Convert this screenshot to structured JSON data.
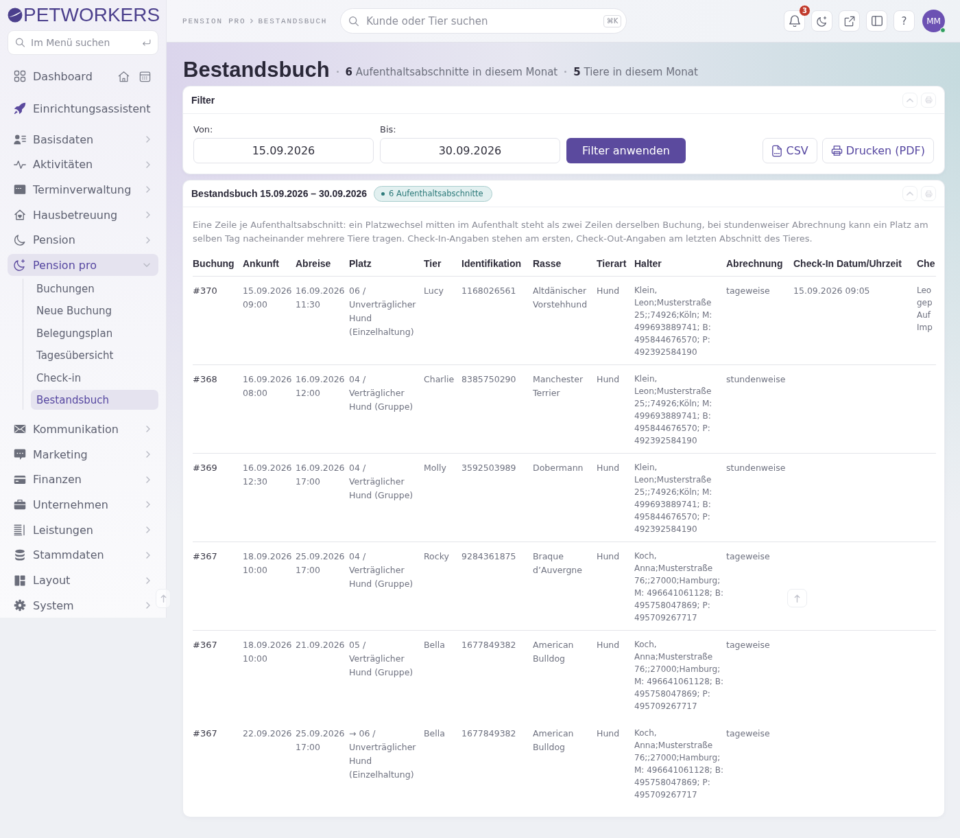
{
  "sidebar": {
    "logo": "PETWORKERS",
    "search": {
      "placeholder": "Im Menü suchen"
    },
    "items": [
      {
        "label": "Dashboard",
        "kind": "shortcuts",
        "selected": false
      },
      {
        "label": "Einrichtungsassistent",
        "kind": "link",
        "selected": false
      },
      {
        "label": "Basisdaten",
        "kind": "group",
        "selected": false,
        "expanded": false
      },
      {
        "label": "Aktivitäten",
        "kind": "group",
        "selected": false,
        "expanded": false
      },
      {
        "label": "Terminverwaltung",
        "kind": "group",
        "selected": false,
        "expanded": false
      },
      {
        "label": "Hausbetreuung",
        "kind": "group",
        "selected": false,
        "expanded": false
      },
      {
        "label": "Pension",
        "kind": "group",
        "selected": false,
        "expanded": false
      },
      {
        "label": "Pension pro",
        "kind": "group",
        "selected": true,
        "expanded": true,
        "children": [
          {
            "label": "Buchungen",
            "selected": false
          },
          {
            "label": "Neue Buchung",
            "selected": false
          },
          {
            "label": "Belegungsplan",
            "selected": false
          },
          {
            "label": "Tagesübersicht",
            "selected": false
          },
          {
            "label": "Check-in",
            "selected": false
          },
          {
            "label": "Bestandsbuch",
            "selected": true
          }
        ]
      },
      {
        "label": "Kommunikation",
        "kind": "group",
        "selected": false,
        "expanded": false
      },
      {
        "label": "Marketing",
        "kind": "group",
        "selected": false,
        "expanded": false
      },
      {
        "label": "Finanzen",
        "kind": "group",
        "selected": false,
        "expanded": false
      },
      {
        "label": "Unternehmen",
        "kind": "group",
        "selected": false,
        "expanded": false
      },
      {
        "label": "Leistungen",
        "kind": "group",
        "selected": false,
        "expanded": false
      },
      {
        "label": "Stammdaten",
        "kind": "group",
        "selected": false,
        "expanded": false
      },
      {
        "label": "Layout",
        "kind": "group",
        "selected": false,
        "expanded": false
      },
      {
        "label": "System",
        "kind": "group",
        "selected": false,
        "expanded": false
      }
    ]
  },
  "header": {
    "breadcrumb": [
      "PENSION PRO",
      "BESTANDSBUCH"
    ],
    "search": {
      "placeholder": "Kunde oder Tier suchen",
      "shortcut": "⌘K"
    },
    "notifications": {
      "count": "3"
    },
    "help": "?",
    "avatar": {
      "initials": "MM",
      "online": true
    }
  },
  "page": {
    "title": "Bestandsbuch",
    "stats": [
      "**6** Aufenthaltsabschnitte in diesem Monat",
      "**5** Tiere in diesem Monat"
    ]
  },
  "filter": {
    "title": "Filter",
    "fields": [
      {
        "label": "Von:",
        "value": "15.09.2026"
      },
      {
        "label": "Bis:",
        "value": "30.09.2026"
      }
    ],
    "apply_button": "Filter anwenden",
    "export_buttons": [
      {
        "kind": "csv",
        "label": "CSV"
      },
      {
        "kind": "print",
        "label": "Drucken (PDF)"
      }
    ]
  },
  "register": {
    "title": "Bestandsbuch 15.09.2026 – 30.09.2026",
    "badge": "6 Aufenthaltsabschnitte",
    "description": "Eine Zeile je Aufenthaltsabschnitt: ein Platzwechsel mitten im Aufenthalt steht als zwei Zeilen derselben Buchung, bei stundenweiser Abrechnung kann ein Platz am selben Tag nacheinander mehrere Tiere tragen. Check-In-Angaben stehen am ersten, Check-Out-Angaben am letzten Abschnitt des Tieres.",
    "table": {
      "columns": [
        "Buchung",
        "Ankunft",
        "Abreise",
        "Platz",
        "Tier",
        "Identifikation",
        "Rasse",
        "Tierart",
        "Halter",
        "Abrechnung",
        "Check-In Datum/Uhrzeit",
        "Che"
      ],
      "rows": [
        {
          "continued": false,
          "booking": "#370",
          "arrival": "15.09.2026 09:00",
          "departure": "16.09.2026 11:30",
          "place": "06 / Unverträglicher Hund (Einzelhaltung)",
          "animal": "Lucy",
          "id_number": "1168026561",
          "breed": "Altdänischer Vorstehhund",
          "species": "Hund",
          "owner": "Klein, Leon;Musterstraße 25;;74926;Köln; M: 499693889741; B: 495844676570; P: 492392584190",
          "billing": "tageweise",
          "check_in": "15.09.2026 09:05",
          "column_12": "Leo gep Auf Imp"
        },
        {
          "continued": false,
          "booking": "#368",
          "arrival": "16.09.2026 08:00",
          "departure": "16.09.2026 12:00",
          "place": "04 / Verträglicher Hund (Gruppe)",
          "animal": "Charlie",
          "id_number": "8385750290",
          "breed": "Manchester Terrier",
          "species": "Hund",
          "owner": "Klein, Leon;Musterstraße 25;;74926;Köln; M: 499693889741; B: 495844676570; P: 492392584190",
          "billing": "stundenweise"
        },
        {
          "continued": false,
          "booking": "#369",
          "arrival": "16.09.2026 12:30",
          "departure": "16.09.2026 17:00",
          "place": "04 / Verträglicher Hund (Gruppe)",
          "animal": "Molly",
          "id_number": "3592503989",
          "breed": "Dobermann",
          "species": "Hund",
          "owner": "Klein, Leon;Musterstraße 25;;74926;Köln; M: 499693889741; B: 495844676570; P: 492392584190",
          "billing": "stundenweise"
        },
        {
          "continued": false,
          "booking": "#367",
          "arrival": "18.09.2026 10:00",
          "departure": "25.09.2026 17:00",
          "place": "04 / Verträglicher Hund (Gruppe)",
          "animal": "Rocky",
          "id_number": "9284361875",
          "breed": "Braque d’Auvergne",
          "species": "Hund",
          "owner": "Koch, Anna;Musterstraße 76;;27000;Hamburg; M: 496641061128; B: 495758047869; P: 495709267717",
          "billing": "tageweise"
        },
        {
          "continued": false,
          "booking": "#367",
          "arrival": "18.09.2026 10:00",
          "departure": "21.09.2026",
          "place": "05 / Verträglicher Hund (Gruppe)",
          "animal": "Bella",
          "id_number": "1677849382",
          "breed": "American Bulldog",
          "species": "Hund",
          "owner": "Koch, Anna;Musterstraße 76;;27000;Hamburg; M: 496641061128; B: 495758047869; P: 495709267717",
          "billing": "tageweise"
        },
        {
          "continued": true,
          "booking": "#367",
          "arrival": "22.09.2026",
          "departure": "25.09.2026 17:00",
          "place": "→ 06 / Unverträglicher Hund (Einzelhaltung)",
          "animal": "Bella",
          "id_number": "1677849382",
          "breed": "American Bulldog",
          "species": "Hund",
          "owner": "Koch, Anna;Musterstraße 76;;27000;Hamburg; M: 496641061128; B: 495758047869; P: 495709267717",
          "billing": "tageweise"
        }
      ]
    }
  }
}
